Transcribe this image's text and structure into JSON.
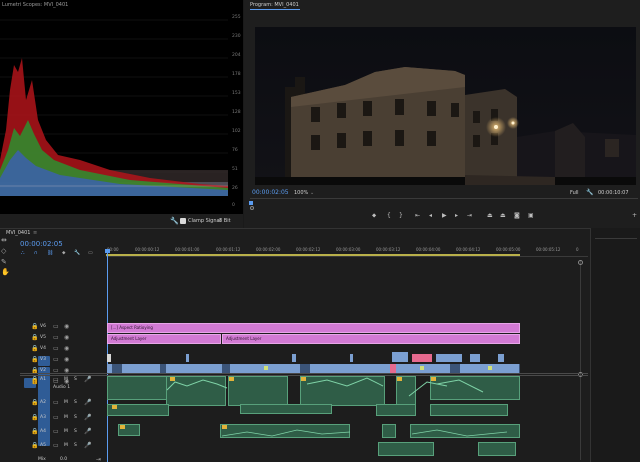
{
  "scopes": {
    "title": "Lumetri Scopes: MVI_0401",
    "ticks": [
      "255",
      "230",
      "204",
      "178",
      "153",
      "128",
      "102",
      "76",
      "51",
      "26",
      "0"
    ],
    "clamp_signal": "Clamp Signal",
    "bit_depth": "8 Bit"
  },
  "program": {
    "title": "Program: MVI_0401",
    "current_timecode": "00:00:02:05",
    "zoom": "100%",
    "quality": "Full",
    "duration": "00:00:10:07",
    "controls": [
      "marker",
      "in",
      "out",
      "go-in",
      "step-back",
      "play",
      "step-forward",
      "go-out",
      "lift",
      "extract",
      "export-frame",
      "compare"
    ]
  },
  "timeline": {
    "title": "MVI_0401",
    "timecode": "00:00:02:05",
    "ruler": [
      "00:00",
      "00:00:00:12",
      "00:00:01:00",
      "00:00:01:12",
      "00:00:02:00",
      "00:00:02:12",
      "00:00:03:00",
      "00:00:03:12",
      "00:00:04:00",
      "00:00:04:12",
      "00:00:05:00",
      "00:00:05:12",
      "0"
    ],
    "video_tracks": [
      {
        "id": "V6",
        "label": "V6"
      },
      {
        "id": "V5",
        "label": "V5"
      },
      {
        "id": "V4",
        "label": "V4"
      },
      {
        "id": "V3",
        "label": "V3"
      },
      {
        "id": "V2",
        "label": "V2"
      },
      {
        "id": "V1",
        "label": "V1"
      }
    ],
    "audio_tracks": [
      {
        "id": "A1",
        "label": "A1",
        "sub": "Audio 1"
      },
      {
        "id": "A2",
        "label": "A2"
      },
      {
        "id": "A3",
        "label": "A3"
      },
      {
        "id": "A4",
        "label": "A4"
      },
      {
        "id": "A5",
        "label": "A5"
      }
    ],
    "master_label": "Mix",
    "master_value": "0.0",
    "clips": {
      "aspect": "[...] Aspect Ratioying",
      "adjustment_1": "Adjustment Layer",
      "adjustment_2": "Adjustment Layer"
    }
  }
}
